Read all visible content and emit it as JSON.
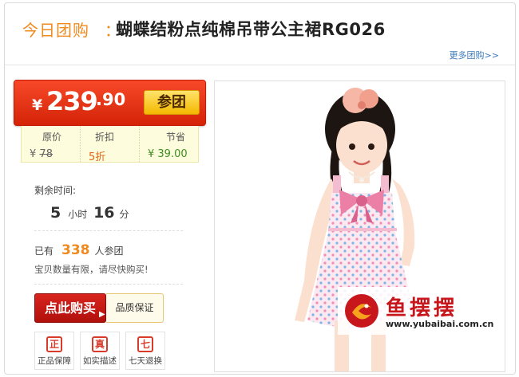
{
  "header": {
    "label": "今日团购",
    "colon": "：",
    "title": "蝴蝶结粉点纯棉吊带公主裙RG026",
    "more_link": "更多团购>>"
  },
  "price": {
    "currency": "¥",
    "integer": "239",
    "decimal": ".90",
    "join_label": "参团"
  },
  "stats": {
    "original_label": "原价",
    "original_currency": "¥",
    "original_value": "78",
    "discount_label": "折扣",
    "discount_value": "5折",
    "save_label": "节省",
    "save_value": "¥ 39.00"
  },
  "countdown": {
    "label": "剩余时间:",
    "hours": "5",
    "hours_unit": "小时",
    "minutes": "16",
    "minutes_unit": "分"
  },
  "participants": {
    "prefix": "已有",
    "count": "338",
    "suffix": "人参团",
    "note": "宝贝数量有限，请尽快购买!"
  },
  "actions": {
    "buy_label": "点此购买",
    "quality_label": "品质保证"
  },
  "badges": [
    {
      "glyph": "正",
      "label": "正品保障"
    },
    {
      "glyph": "真",
      "label": "如实描述"
    },
    {
      "glyph": "七",
      "label": "七天退换"
    }
  ],
  "watermark": {
    "brand": "鱼摆摆",
    "url": "www.yubaibai.com.cn"
  },
  "colors": {
    "accent_orange": "#f08a1e",
    "price_red": "#e3341a",
    "join_yellow": "#f5b800",
    "buy_red": "#c3160f",
    "link_blue": "#3a79b8"
  }
}
